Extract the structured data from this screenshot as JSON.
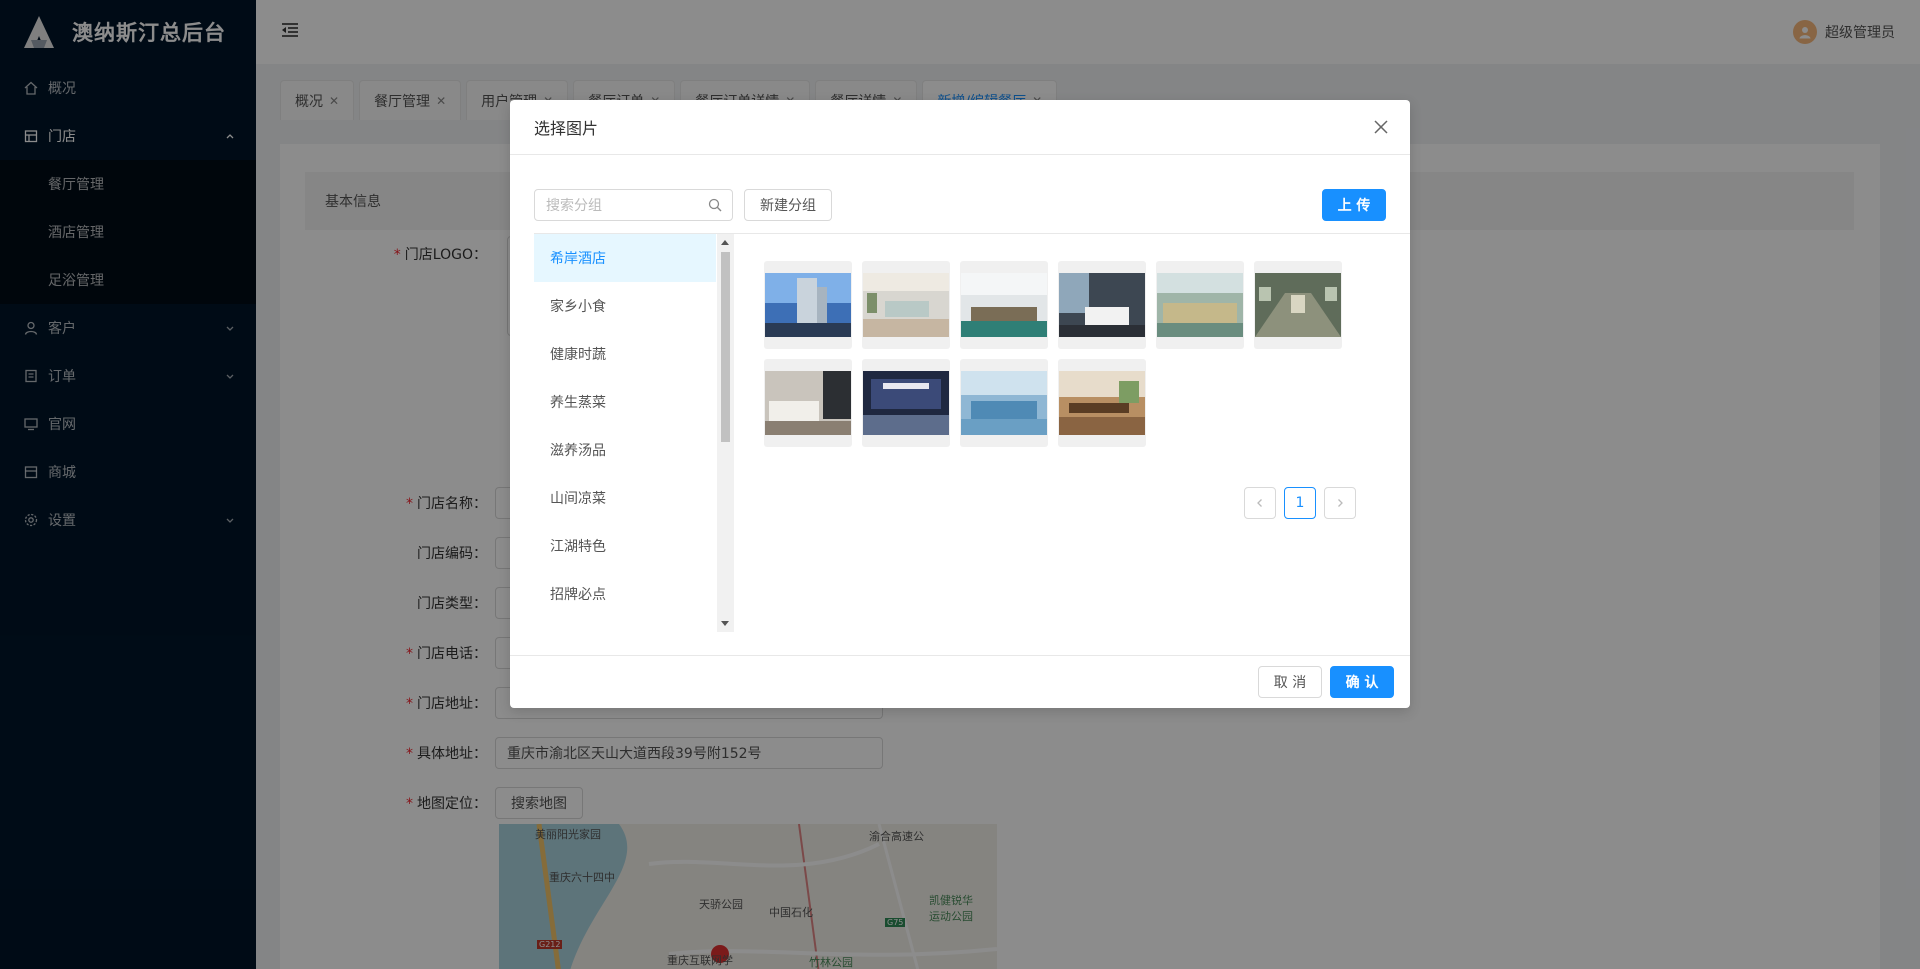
{
  "app": {
    "title": "澳纳斯汀总后台"
  },
  "sidebar": {
    "items": [
      {
        "label": "概况",
        "icon": "home-icon"
      },
      {
        "label": "门店",
        "icon": "store-icon",
        "open": true,
        "children": [
          {
            "label": "餐厅管理"
          },
          {
            "label": "酒店管理"
          },
          {
            "label": "足浴管理"
          }
        ]
      },
      {
        "label": "客户",
        "icon": "user-icon"
      },
      {
        "label": "订单",
        "icon": "order-icon"
      },
      {
        "label": "官网",
        "icon": "desktop-icon"
      },
      {
        "label": "商城",
        "icon": "shop-icon"
      },
      {
        "label": "设置",
        "icon": "setting-icon"
      }
    ]
  },
  "header": {
    "user_name": "超级管理员"
  },
  "tabs": [
    {
      "label": "概况"
    },
    {
      "label": "餐厅管理"
    },
    {
      "label": "用户管理"
    },
    {
      "label": "餐厅订单"
    },
    {
      "label": "餐厅订单详情"
    },
    {
      "label": "餐厅详情"
    },
    {
      "label": "新增/编辑餐厅",
      "active": true
    }
  ],
  "form": {
    "section_title": "基本信息",
    "logo_label": "门店LOGO：",
    "name_label": "门店名称：",
    "code_label": "门店编码：",
    "type_label": "门店类型：",
    "phone_label": "门店电话：",
    "address_label": "门店地址：",
    "detail_address_label": "具体地址：",
    "detail_address_value": "重庆市渝北区天山大道西段39号附152号",
    "map_label": "地图定位：",
    "map_search_button": "搜索地图",
    "map_places": {
      "p1": "美丽阳光家园",
      "p2": "重庆六十四中",
      "p3": "渝合高速公",
      "p4": "天骄公园",
      "p5": "中国石化",
      "p6": "凯健锐华运动公园",
      "p7": "重庆互联网学",
      "p8": "竹林公园",
      "road1": "G212",
      "road2": "G75"
    }
  },
  "modal": {
    "title": "选择图片",
    "search_placeholder": "搜索分组",
    "new_group_button": "新建分组",
    "upload_button": "上 传",
    "groups": [
      {
        "label": "希岸酒店",
        "active": true
      },
      {
        "label": "家乡小食"
      },
      {
        "label": "健康时蔬"
      },
      {
        "label": "养生蒸菜"
      },
      {
        "label": "滋养汤品"
      },
      {
        "label": "山间凉菜"
      },
      {
        "label": "江湖特色"
      },
      {
        "label": "招牌必点"
      }
    ],
    "images": [
      {
        "subject": "hotel-tower"
      },
      {
        "subject": "hotel-lobby"
      },
      {
        "subject": "meeting-room"
      },
      {
        "subject": "guest-room"
      },
      {
        "subject": "banquet-hall"
      },
      {
        "subject": "corridor"
      },
      {
        "subject": "twin-room"
      },
      {
        "subject": "hotel-facade-night"
      },
      {
        "subject": "restaurant"
      },
      {
        "subject": "dining-area"
      }
    ],
    "pagination": {
      "current": "1"
    },
    "cancel_button": "取 消",
    "confirm_button": "确 认"
  },
  "colors": {
    "primary": "#1890ff",
    "sidebar_bg": "#001529",
    "submenu_bg": "#000c17"
  }
}
